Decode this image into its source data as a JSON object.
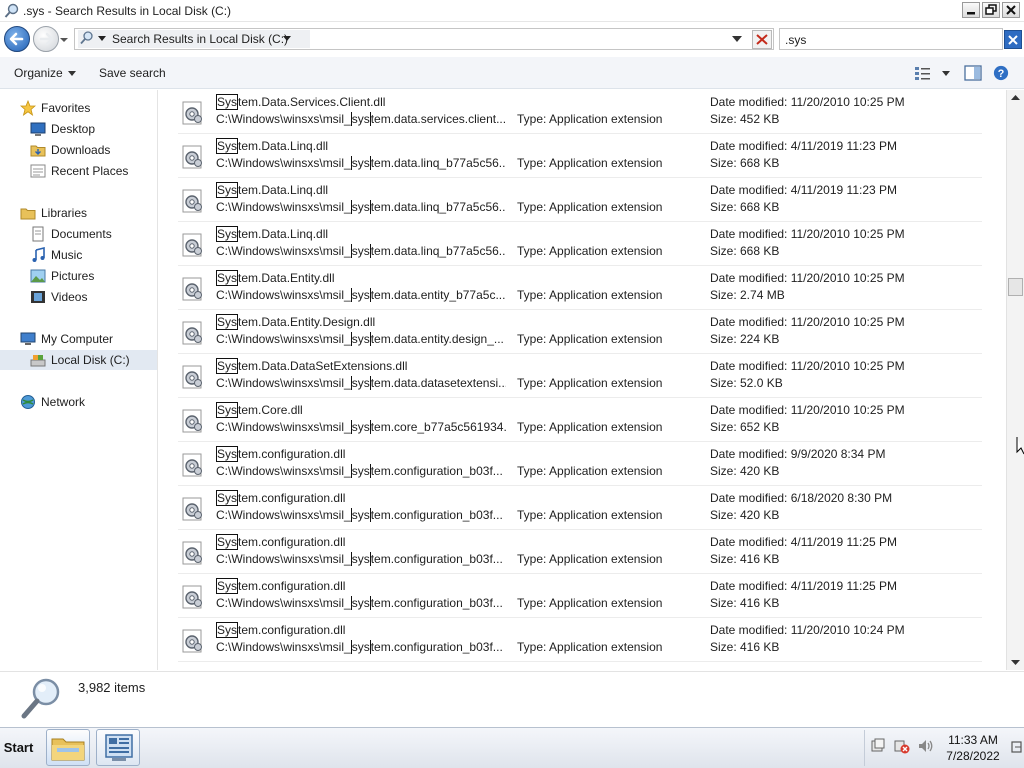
{
  "window": {
    "title": ".sys - Search Results in Local Disk (C:)"
  },
  "address": {
    "path": "Search Results in Local Disk (C:)"
  },
  "search": {
    "value": ".sys"
  },
  "toolbar": {
    "organize": "Organize",
    "save_search": "Save search"
  },
  "nav": {
    "favorites": "Favorites",
    "desktop": "Desktop",
    "downloads": "Downloads",
    "recent_places": "Recent Places",
    "libraries": "Libraries",
    "documents": "Documents",
    "music": "Music",
    "pictures": "Pictures",
    "videos": "Videos",
    "my_computer": "My Computer",
    "local_disk": "Local Disk (C:)",
    "network": "Network"
  },
  "results": {
    "type_label": "Type: Application extension",
    "highlight_name": "Sys",
    "highlight_path": "sys",
    "rows": [
      {
        "name_rest": "tem.Data.Services.Client.dll",
        "path_pre": "C:\\Windows\\winsxs\\msil_",
        "path_rest": "tem.data.services.client...",
        "date": "Date modified: 11/20/2010 10:25 PM",
        "size": "Size: 452 KB"
      },
      {
        "name_rest": "tem.Data.Linq.dll",
        "path_pre": "C:\\Windows\\winsxs\\msil_",
        "path_rest": "tem.data.linq_b77a5c56...",
        "date": "Date modified: 4/11/2019 11:23 PM",
        "size": "Size: 668 KB"
      },
      {
        "name_rest": "tem.Data.Linq.dll",
        "path_pre": "C:\\Windows\\winsxs\\msil_",
        "path_rest": "tem.data.linq_b77a5c56...",
        "date": "Date modified: 4/11/2019 11:23 PM",
        "size": "Size: 668 KB"
      },
      {
        "name_rest": "tem.Data.Linq.dll",
        "path_pre": "C:\\Windows\\winsxs\\msil_",
        "path_rest": "tem.data.linq_b77a5c56...",
        "date": "Date modified: 11/20/2010 10:25 PM",
        "size": "Size: 668 KB"
      },
      {
        "name_rest": "tem.Data.Entity.dll",
        "path_pre": "C:\\Windows\\winsxs\\msil_",
        "path_rest": "tem.data.entity_b77a5c...",
        "date": "Date modified: 11/20/2010 10:25 PM",
        "size": "Size: 2.74 MB"
      },
      {
        "name_rest": "tem.Data.Entity.Design.dll",
        "path_pre": "C:\\Windows\\winsxs\\msil_",
        "path_rest": "tem.data.entity.design_...",
        "date": "Date modified: 11/20/2010 10:25 PM",
        "size": "Size: 224 KB"
      },
      {
        "name_rest": "tem.Data.DataSetExtensions.dll",
        "path_pre": "C:\\Windows\\winsxs\\msil_",
        "path_rest": "tem.data.datasetextensi...",
        "date": "Date modified: 11/20/2010 10:25 PM",
        "size": "Size: 52.0 KB"
      },
      {
        "name_rest": "tem.Core.dll",
        "path_pre": "C:\\Windows\\winsxs\\msil_",
        "path_rest": "tem.core_b77a5c561934...",
        "date": "Date modified: 11/20/2010 10:25 PM",
        "size": "Size: 652 KB"
      },
      {
        "name_rest": "tem.configuration.dll",
        "path_pre": "C:\\Windows\\winsxs\\msil_",
        "path_rest": "tem.configuration_b03f...",
        "date": "Date modified: 9/9/2020 8:34 PM",
        "size": "Size: 420 KB"
      },
      {
        "name_rest": "tem.configuration.dll",
        "path_pre": "C:\\Windows\\winsxs\\msil_",
        "path_rest": "tem.configuration_b03f...",
        "date": "Date modified: 6/18/2020 8:30 PM",
        "size": "Size: 420 KB"
      },
      {
        "name_rest": "tem.configuration.dll",
        "path_pre": "C:\\Windows\\winsxs\\msil_",
        "path_rest": "tem.configuration_b03f...",
        "date": "Date modified: 4/11/2019 11:25 PM",
        "size": "Size: 416 KB"
      },
      {
        "name_rest": "tem.configuration.dll",
        "path_pre": "C:\\Windows\\winsxs\\msil_",
        "path_rest": "tem.configuration_b03f...",
        "date": "Date modified: 4/11/2019 11:25 PM",
        "size": "Size: 416 KB"
      },
      {
        "name_rest": "tem.configuration.dll",
        "path_pre": "C:\\Windows\\winsxs\\msil_",
        "path_rest": "tem.configuration_b03f...",
        "date": "Date modified: 11/20/2010 10:24 PM",
        "size": "Size: 416 KB"
      }
    ]
  },
  "details": {
    "item_count": "3,982 items"
  },
  "taskbar": {
    "start": "Start",
    "time": "11:33 AM",
    "date": "7/28/2022"
  },
  "colors": {
    "accent": "#2e6cc2",
    "selection": "#e2e9f2"
  },
  "icons": [
    "search-icon",
    "back-arrow-icon",
    "forward-arrow-icon",
    "star-icon",
    "folder-icon",
    "computer-icon",
    "drive-icon",
    "network-icon",
    "dll-file-icon",
    "views-icon",
    "preview-pane-icon",
    "help-icon",
    "magnifier-icon",
    "explorer-icon",
    "server-manager-icon"
  ]
}
